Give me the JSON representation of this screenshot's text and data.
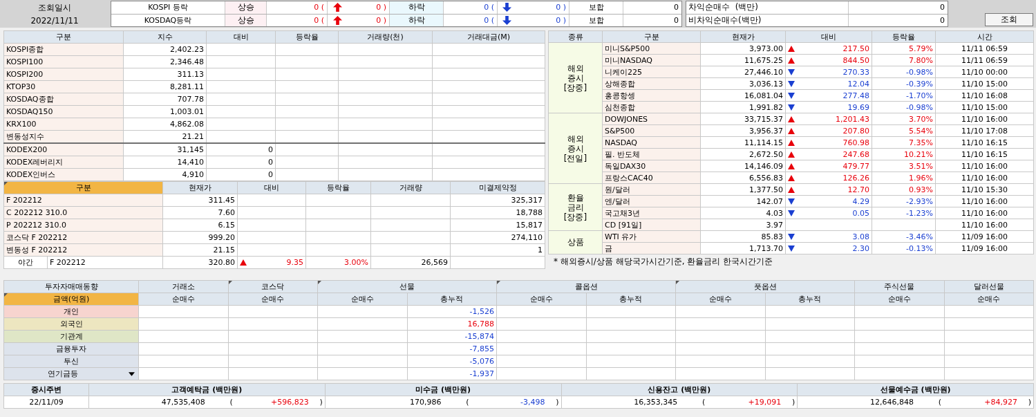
{
  "header": {
    "query_label": "조회일시",
    "query_date": "2022/11/11",
    "search_button": "조회"
  },
  "breadth": [
    {
      "name": "KOSPI 등락",
      "up_label": "상승",
      "up_open": "0 (",
      "up_close": "0 )",
      "down_label": "하락",
      "down_open": "0 (",
      "down_close": "0 )",
      "flat_label": "보합",
      "flat_value": "0"
    },
    {
      "name": "KOSDAQ등락",
      "up_label": "상승",
      "up_open": "0 (",
      "up_close": "0 )",
      "down_label": "하락",
      "down_open": "0 (",
      "down_close": "0 )",
      "flat_label": "보합",
      "flat_value": "0"
    }
  ],
  "program_trading": [
    {
      "label": "차익순매수  (백만)",
      "value": "0"
    },
    {
      "label": "비차익순매수(백만)",
      "value": "0"
    }
  ],
  "index_table": {
    "columns": [
      "구분",
      "지수",
      "대비",
      "등락율",
      "거래량(천)",
      "거래대금(M)"
    ],
    "indices": [
      {
        "name": "KOSPI종합",
        "value": "2,402.23"
      },
      {
        "name": "KOSPI100",
        "value": "2,346.48"
      },
      {
        "name": "KOSPI200",
        "value": "311.13"
      },
      {
        "name": "KTOP30",
        "value": "8,281.11"
      },
      {
        "name": "KOSDAQ종합",
        "value": "707.78"
      },
      {
        "name": "KOSDAQ150",
        "value": "1,003.01"
      },
      {
        "name": "KRX100",
        "value": "4,862.08"
      },
      {
        "name": "변동성지수",
        "value": "21.21"
      }
    ],
    "etfs": [
      {
        "name": "KODEX200",
        "value": "31,145",
        "change": "0"
      },
      {
        "name": "KODEX레버리지",
        "value": "14,410",
        "change": "0"
      },
      {
        "name": "KODEX인버스",
        "value": "4,910",
        "change": "0"
      }
    ]
  },
  "futures_table": {
    "columns": [
      "구분",
      "현재가",
      "대비",
      "등락율",
      "거래량",
      "미결제약정"
    ],
    "rows": [
      {
        "name": "F 202212",
        "price": "311.45",
        "open_interest": "325,317"
      },
      {
        "name": "C 202212 310.0",
        "price": "7.60",
        "open_interest": "18,788"
      },
      {
        "name": "P 202212 310.0",
        "price": "6.15",
        "open_interest": "15,817"
      },
      {
        "name": "코스닥 F 202212",
        "price": "999.20",
        "open_interest": "274,110"
      },
      {
        "name": "변동성 F 202212",
        "price": "21.15",
        "open_interest": "1"
      }
    ],
    "night": {
      "session": "야간",
      "name": "F 202212",
      "price": "320.80",
      "rising": true,
      "change": "9.35",
      "rate": "3.00%",
      "volume": "26,569"
    }
  },
  "world_table": {
    "columns": [
      "종류",
      "구분",
      "현재가",
      "대비",
      "등락율",
      "시간"
    ],
    "groups": [
      {
        "label_lines": [
          "해외",
          "증시",
          "[장중]"
        ],
        "rows": [
          {
            "name": "미니S&P500",
            "price": "3,973.00",
            "rising": true,
            "change": "217.50",
            "rate": "5.79%",
            "time": "11/11 06:59"
          },
          {
            "name": "미니NASDAQ",
            "price": "11,675.25",
            "rising": true,
            "change": "844.50",
            "rate": "7.80%",
            "time": "11/11 06:59"
          },
          {
            "name": "니케이225",
            "price": "27,446.10",
            "rising": false,
            "change": "270.33",
            "rate": "-0.98%",
            "time": "11/10 00:00"
          },
          {
            "name": "상해종합",
            "price": "3,036.13",
            "rising": false,
            "change": "12.04",
            "rate": "-0.39%",
            "time": "11/10 15:00"
          },
          {
            "name": "홍콩항셍",
            "price": "16,081.04",
            "rising": false,
            "change": "277.48",
            "rate": "-1.70%",
            "time": "11/10 16:08"
          },
          {
            "name": "심천종합",
            "price": "1,991.82",
            "rising": false,
            "change": "19.69",
            "rate": "-0.98%",
            "time": "11/10 15:00"
          }
        ]
      },
      {
        "label_lines": [
          "해외",
          "증시",
          "[전일]"
        ],
        "rows": [
          {
            "name": "DOWJONES",
            "price": "33,715.37",
            "rising": true,
            "change": "1,201.43",
            "rate": "3.70%",
            "time": "11/10 16:00"
          },
          {
            "name": "S&P500",
            "price": "3,956.37",
            "rising": true,
            "change": "207.80",
            "rate": "5.54%",
            "time": "11/10 17:08"
          },
          {
            "name": "NASDAQ",
            "price": "11,114.15",
            "rising": true,
            "change": "760.98",
            "rate": "7.35%",
            "time": "11/10 16:15"
          },
          {
            "name": "필. 반도체",
            "price": "2,672.50",
            "rising": true,
            "change": "247.68",
            "rate": "10.21%",
            "time": "11/10 16:15"
          },
          {
            "name": "독일DAX30",
            "price": "14,146.09",
            "rising": true,
            "change": "479.77",
            "rate": "3.51%",
            "time": "11/10 16:00"
          },
          {
            "name": "프랑스CAC40",
            "price": "6,556.83",
            "rising": true,
            "change": "126.26",
            "rate": "1.96%",
            "time": "11/10 16:00"
          }
        ]
      },
      {
        "label_lines": [
          "환율",
          "금리",
          "[장중]"
        ],
        "rows": [
          {
            "name": "원/달러",
            "price": "1,377.50",
            "rising": true,
            "change": "12.70",
            "rate": "0.93%",
            "time": "11/10 15:30"
          },
          {
            "name": "엔/달러",
            "price": "142.07",
            "rising": false,
            "change": "4.29",
            "rate": "-2.93%",
            "time": "11/10 16:00"
          },
          {
            "name": "국고채3년",
            "price": "4.03",
            "rising": false,
            "change": "0.05",
            "rate": "-1.23%",
            "time": "11/10 16:00"
          },
          {
            "name": "CD [91일]",
            "price": "3.97",
            "time": "11/10 16:00"
          }
        ]
      },
      {
        "label_lines": [
          "상품"
        ],
        "rows": [
          {
            "name": "WTI 유가",
            "price": "85.83",
            "rising": false,
            "change": "3.08",
            "rate": "-3.46%",
            "time": "11/09 16:00"
          },
          {
            "name": "금",
            "price": "1,713.70",
            "rising": false,
            "change": "2.30",
            "rate": "-0.13%",
            "time": "11/09 16:00"
          }
        ]
      }
    ],
    "note": "* 해외증시/상품 해당국가시간기준, 환율금리 한국시간기준"
  },
  "investor_table": {
    "title": "투자자매매동향",
    "unit_selector": "금액(억원)",
    "markets": [
      {
        "label": "거래소",
        "subcolumns": [
          "순매수"
        ]
      },
      {
        "label": "코스닥",
        "subcolumns": [
          "순매수"
        ]
      },
      {
        "label": "선물",
        "subcolumns": [
          "순매수",
          "총누적"
        ]
      },
      {
        "label": "콜옵션",
        "subcolumns": [
          "순매수",
          "총누적"
        ]
      },
      {
        "label": "풋옵션",
        "subcolumns": [
          "순매수",
          "총누적"
        ]
      },
      {
        "label": "주식선물",
        "subcolumns": [
          "순매수"
        ]
      },
      {
        "label": "달러선물",
        "subcolumns": [
          "순매수"
        ]
      }
    ],
    "rows": [
      {
        "name": "개인",
        "color": "#f7d4cf",
        "kind": "plain",
        "futures_total": "-1,526",
        "rising": false
      },
      {
        "name": "외국인",
        "color": "#ede6c0",
        "kind": "plain",
        "futures_total": "16,788",
        "rising": true
      },
      {
        "name": "기관계",
        "color": "#dfe6c6",
        "kind": "plain",
        "futures_total": "-15,874",
        "rising": false
      },
      {
        "name": "금융투자",
        "color": "#dde3ec",
        "kind": "plain",
        "futures_total": "-7,855",
        "rising": false
      },
      {
        "name": "투신",
        "color": "#dde3ec",
        "kind": "plain",
        "futures_total": "-5,076",
        "rising": false
      },
      {
        "name": "연기금등",
        "color": "#dde3ec",
        "kind": "dropdown",
        "futures_total": "-1,937",
        "rising": false
      }
    ]
  },
  "market_summary": {
    "columns": [
      "증시주변",
      "고객예탁금 (백만원)",
      "미수금 (백만원)",
      "신용잔고 (백만원)",
      "선물예수금 (백만원)"
    ],
    "date": "22/11/09",
    "items": [
      {
        "value": "47,535,408",
        "paren_open": "(",
        "change": "+596,823",
        "paren_close": ")",
        "rising": true
      },
      {
        "value": "170,986",
        "paren_open": "(",
        "change": "-3,498",
        "paren_close": ")",
        "rising": false
      },
      {
        "value": "16,353,345",
        "paren_open": "(",
        "change": "+19,091",
        "paren_close": ")",
        "rising": true
      },
      {
        "value": "12,646,848",
        "paren_open": "(",
        "change": "+84,927",
        "paren_close": ")",
        "rising": true
      }
    ]
  }
}
